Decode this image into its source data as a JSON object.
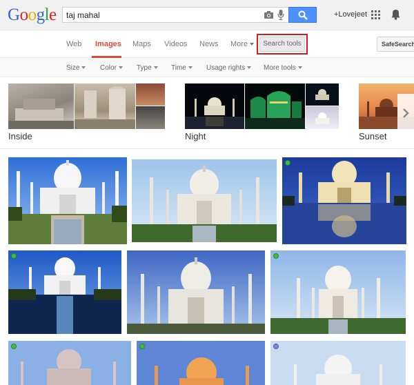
{
  "header": {
    "logo": {
      "G": "G",
      "o1": "o",
      "o2": "o",
      "g": "g",
      "l": "l",
      "e": "e"
    },
    "query": "taj mahal",
    "user": "+Lovejeet"
  },
  "tabs": {
    "web": "Web",
    "images": "Images",
    "maps": "Maps",
    "videos": "Videos",
    "news": "News",
    "more": "More",
    "search_tools": "Search tools",
    "safesearch": "SafeSearch"
  },
  "tools": {
    "size": "Size",
    "color": "Color",
    "type": "Type",
    "time": "Time",
    "usage_rights": "Usage rights",
    "more_tools": "More tools"
  },
  "related": [
    {
      "label": "Inside"
    },
    {
      "label": "Night"
    },
    {
      "label": "Sunset"
    }
  ],
  "colors": {
    "accent_red": "#dd4b39",
    "search_blue": "#4d90fe",
    "highlight_red": "#d21c1c"
  }
}
